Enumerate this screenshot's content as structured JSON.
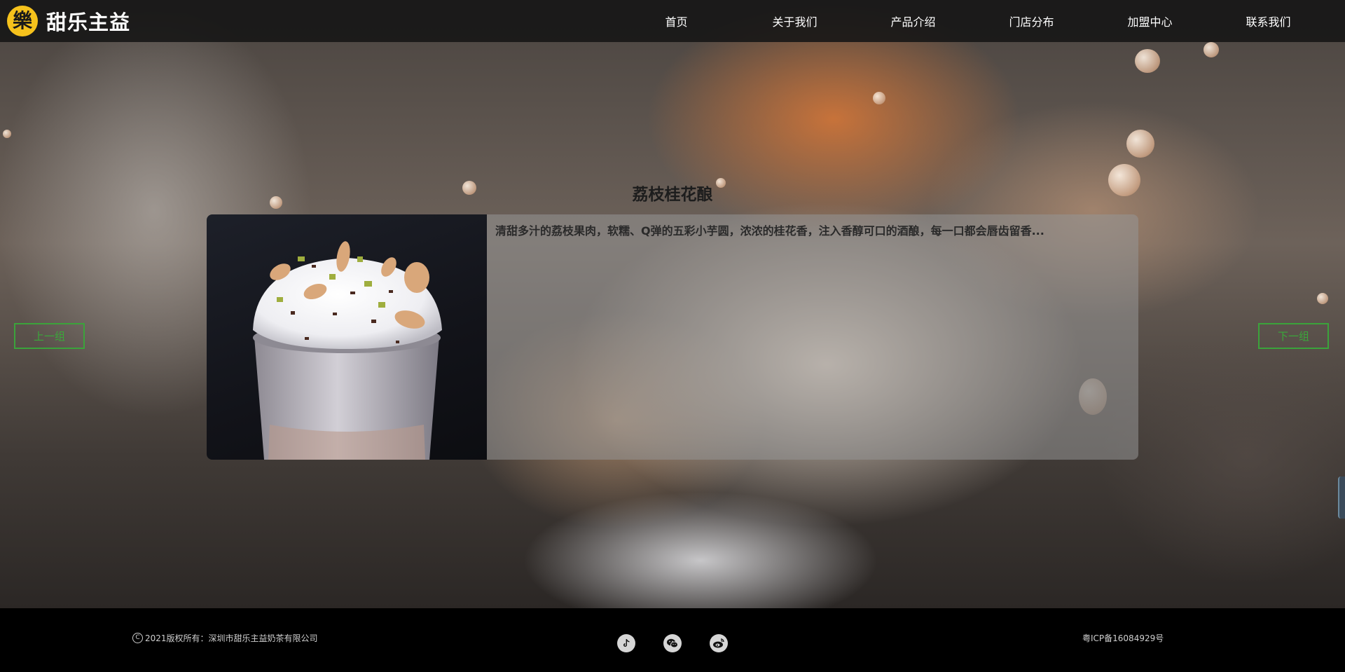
{
  "brand": {
    "badge_glyph": "樂",
    "name": "甜乐主益",
    "badge_color": "#f6c21c"
  },
  "nav": {
    "items": [
      {
        "label": "首页"
      },
      {
        "label": "关于我们"
      },
      {
        "label": "产品介绍"
      },
      {
        "label": "门店分布"
      },
      {
        "label": "加盟中心"
      },
      {
        "label": "联系我们"
      }
    ]
  },
  "carousel": {
    "product_title": "荔枝桂花酿",
    "product_description": "清甜多汁的荔枝果肉，软糯、Q弹的五彩小芋圆，浓浓的桂花香，注入香醇可口的酒酿，每一口都会唇齿留香...",
    "prev_label": "上一组",
    "next_label": "下一组",
    "button_color": "#3ba33b"
  },
  "footer": {
    "copyright_symbol": "C",
    "copyright_text": "2021版权所有：深圳市甜乐主益奶茶有限公司",
    "icp": "粤ICP备16084929号",
    "social_icons": [
      "tiktok-icon",
      "wechat-icon",
      "weibo-icon"
    ]
  }
}
